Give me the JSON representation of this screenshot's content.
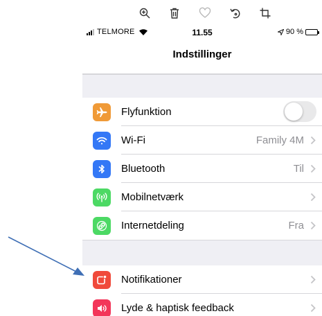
{
  "colors": {
    "airplane": "#f09a37",
    "wifi": "#3478f6",
    "bluetooth": "#3478f6",
    "cellular": "#4cd964",
    "hotspot": "#4cd964",
    "notifications": "#f04a3b",
    "sounds": "#f3365a",
    "arrow": "#3f6fb5",
    "group_gap": "#efeff4"
  },
  "toolbar": {
    "icons": [
      "zoom-in-icon",
      "trash-icon",
      "heart-icon",
      "rotate-icon",
      "crop-icon"
    ]
  },
  "statusbar": {
    "carrier": "TELMORE",
    "time": "11.55",
    "battery": "90 %"
  },
  "nav": {
    "title": "Indstillinger"
  },
  "rows": [
    {
      "label": "Flyfunktion",
      "value": "",
      "icon": "airplane-icon",
      "toggle": "off"
    },
    {
      "label": "Wi-Fi",
      "value": "Family 4M",
      "icon": "wifi-icon"
    },
    {
      "label": "Bluetooth",
      "value": "Til",
      "icon": "bluetooth-icon"
    },
    {
      "label": "Mobilnetværk",
      "value": "",
      "icon": "antenna-icon"
    },
    {
      "label": "Internetdeling",
      "value": "Fra",
      "icon": "hotspot-icon"
    },
    {
      "label": "Notifikationer",
      "value": "",
      "icon": "notification-icon"
    },
    {
      "label": "Lyde & haptisk feedback",
      "value": "",
      "icon": "speaker-icon"
    }
  ]
}
